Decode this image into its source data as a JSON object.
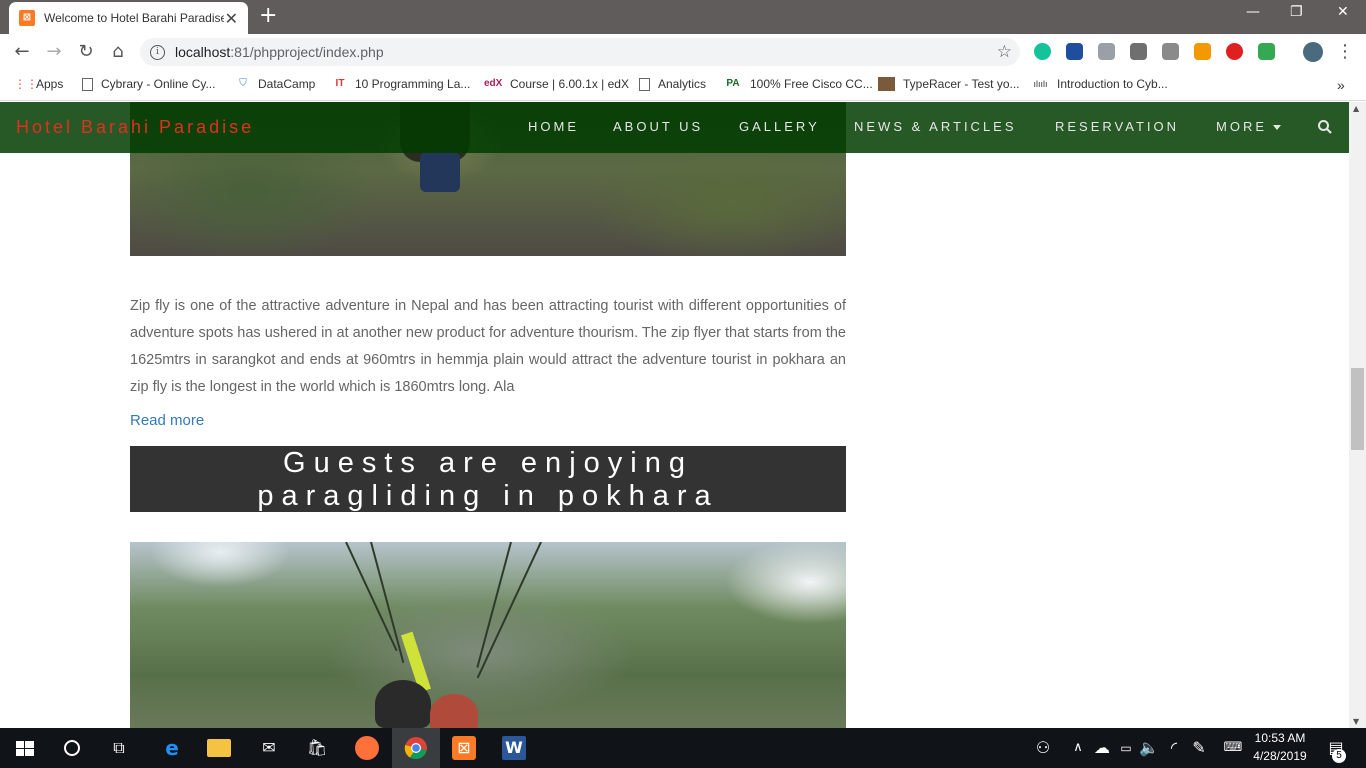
{
  "browser": {
    "tab_title": "Welcome to Hotel Barahi Paradise",
    "url_host": "localhost",
    "url_path": ":81/phpproject/index.php",
    "new_tab_symbol": "+",
    "close_symbol": "✕"
  },
  "bookmarks": [
    {
      "label": "Apps",
      "icon": "apps-grid-icon"
    },
    {
      "label": "Cybrary - Online Cy...",
      "icon": "page-icon"
    },
    {
      "label": "DataCamp",
      "icon": "shield-icon"
    },
    {
      "label": "10 Programming La...",
      "icon": "it-icon"
    },
    {
      "label": "Course | 6.00.1x | edX",
      "icon": "edx-icon"
    },
    {
      "label": "Analytics",
      "icon": "page-icon"
    },
    {
      "label": "100% Free Cisco CC...",
      "icon": "pa-icon"
    },
    {
      "label": "TypeRacer - Test yo...",
      "icon": "typeracer-icon"
    },
    {
      "label": "Introduction to Cyb...",
      "icon": "cisco-icon"
    }
  ],
  "site": {
    "brand": "Hotel Barahi Paradise",
    "brand_color": "#e0301e",
    "nav": {
      "home": "HOME",
      "about": "ABOUT US",
      "gallery": "GALLERY",
      "news": "NEWS & ARTICLES",
      "reservation": "RESERVATION",
      "more": "MORE"
    },
    "article": {
      "text": "Zip fly is one of the attractive adventure in Nepal and has been attracting tourist with different opportunities of adventure spots has ushered in at another new product for adventure thourism. The zip flyer that starts from the 1625mtrs in sarangkot and ends at 960mtrs in hemmja plain would attract the adventure tourist in pokhara an zip fly is the longest in the world which is 1860mtrs long. Ala",
      "read_more": "Read more"
    },
    "caption": {
      "line1": "Guests are enjoying",
      "line2": "paragliding in pokhara"
    }
  },
  "taskbar": {
    "time": "10:53 AM",
    "date": "4/28/2019",
    "notifications": "5"
  }
}
